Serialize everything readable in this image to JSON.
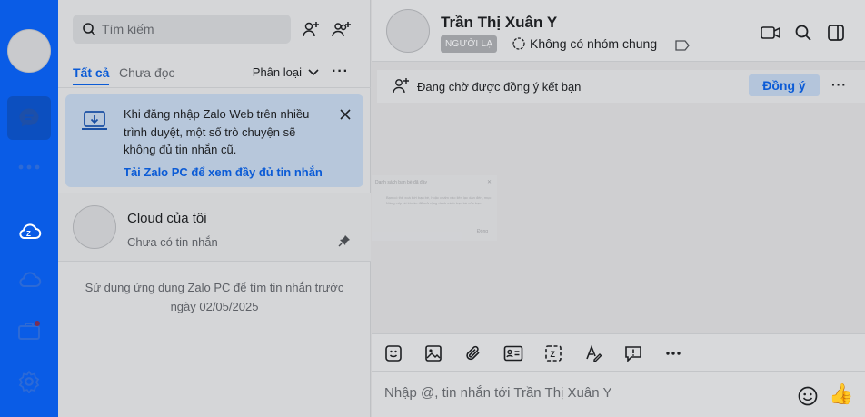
{
  "sidebar": {
    "icons": [
      "avatar",
      "chat-icon",
      "more-dots-icon",
      "zcloud-icon",
      "cloud-icon",
      "briefcase-icon",
      "settings-icon"
    ]
  },
  "search": {
    "placeholder": "Tìm kiếm"
  },
  "tabs": {
    "all": "Tất cả",
    "unread": "Chưa đọc",
    "classify": "Phân loại",
    "more": "···"
  },
  "notice": {
    "text": "Khi đăng nhập Zalo Web trên nhiều trình duyệt, một số trò chuyện sẽ không đủ tin nhắn cũ.",
    "link": "Tải Zalo PC để xem đầy đủ tin nhắn"
  },
  "conversations": [
    {
      "name": "Cloud của tôi",
      "last_message": "Chưa có tin nhắn",
      "pinned": true
    }
  ],
  "old_messages_note": "Sử dụng ứng dụng Zalo PC để tìm tin nhắn trước ngày 02/05/2025",
  "chat": {
    "name": "Trần Thị Xuân Y",
    "badge": "NGƯỜI LẠ",
    "common_groups": "Không có nhóm chung",
    "friend_request": "Đang chờ được đồng ý kết bạn",
    "accept_label": "Đồng ý",
    "more": "···",
    "ghost_dialog": {
      "title": "Danh sách bạn bè đã đầy",
      "close": "✕",
      "body": "Bạn có thể xoá bớt bạn bè, hoặc chấm vào liên lạc dẫn đến, mục Nâng cấp tài khoản để mở rộng danh sách bạn bè của bạn.",
      "button": "Đóng"
    },
    "composer_placeholder": "Nhập @, tin nhắn tới Trần Thị Xuân Y",
    "toolbar_more": "···",
    "thumb": "👍"
  },
  "colors": {
    "rail": "#0a5ce6",
    "accent": "#0b5bd6",
    "notice_bg": "#b7c7db"
  }
}
